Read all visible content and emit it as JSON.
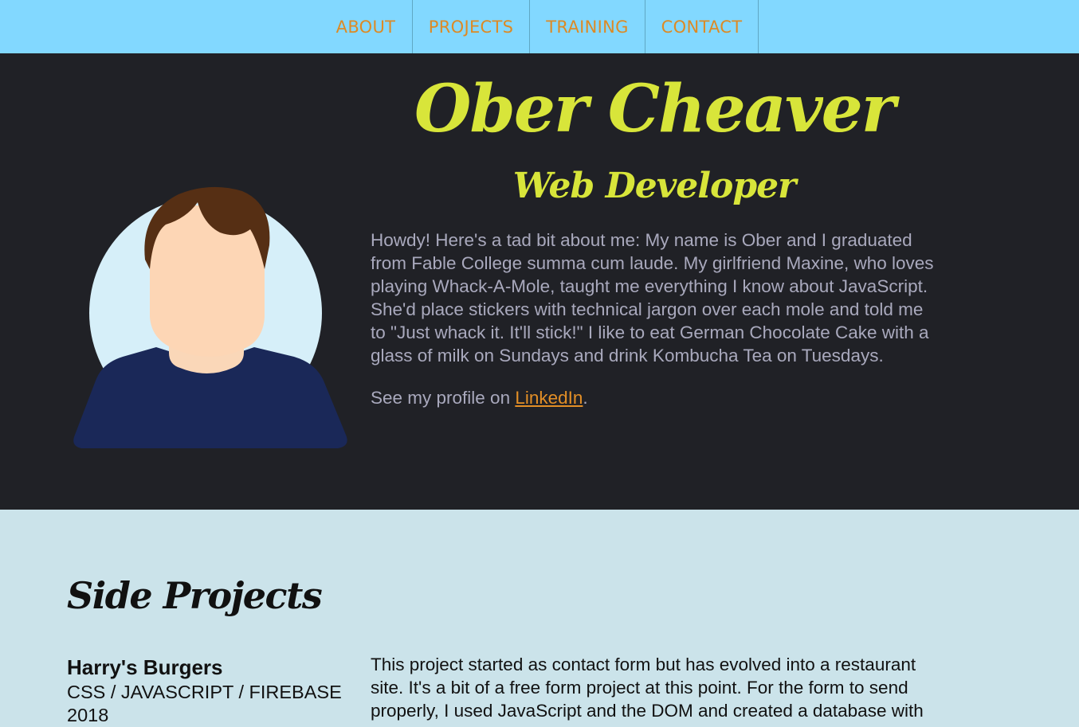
{
  "nav": {
    "items": [
      {
        "label": "ABOUT"
      },
      {
        "label": "PROJECTS"
      },
      {
        "label": "TRAINING"
      },
      {
        "label": "CONTACT"
      }
    ]
  },
  "hero": {
    "name": "Ober Cheaver",
    "role": "Web Developer",
    "bio": "Howdy! Here's a tad bit about me: My name is Ober and I graduated from Fable College summa cum laude. My girlfriend Maxine, who loves playing Whack-A-Mole, taught me everything I know about JavaScript. She'd place stickers with technical jargon over each mole and told me to \"Just whack it. It'll stick!\" I like to eat German Chocolate Cake with a glass of milk on Sundays and drink Kombucha Tea on Tuesdays.",
    "profile_prefix": "See my profile on ",
    "profile_link": "LinkedIn",
    "profile_suffix": ".",
    "avatar_icon": "person-avatar-icon"
  },
  "projects": {
    "section_title": "Side Projects",
    "items": [
      {
        "title": "Harry's Burgers",
        "tech": "CSS / JAVASCRIPT / FIREBASE",
        "year": "2018",
        "description": "This project started as contact form but has evolved into a restaurant site. It's a bit of a free form project at this point. For the form to send properly, I used JavaScript and the DOM and created a database with"
      }
    ]
  },
  "colors": {
    "nav_bg": "#82d8ff",
    "nav_text": "#dd8a24",
    "hero_bg": "#202126",
    "accent": "#d8e53a",
    "body_text": "#a9a9bd",
    "link": "#e38f26",
    "projects_bg": "#cbe3ea"
  }
}
